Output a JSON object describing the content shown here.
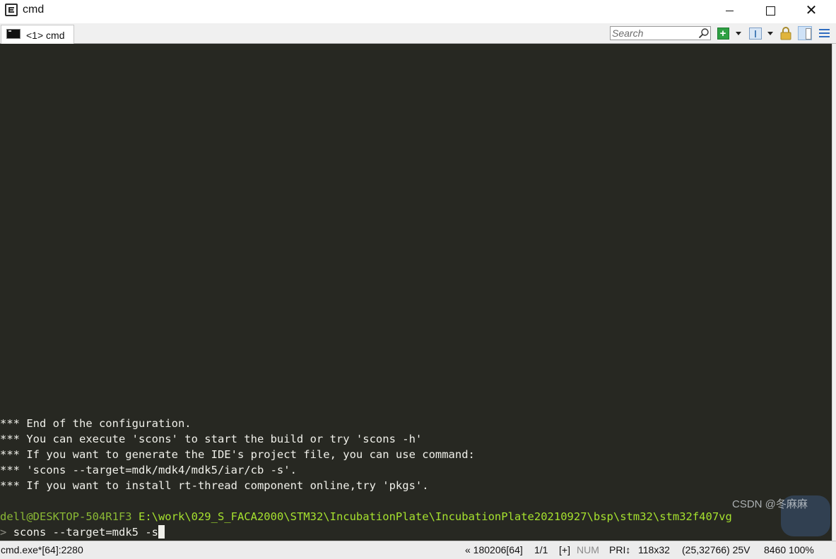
{
  "window": {
    "title": "cmd",
    "icon": "conemu-app-icon",
    "controls": [
      "minimize-icon",
      "maximize-icon",
      "close-icon"
    ]
  },
  "tabs": [
    {
      "label": "<1> cmd",
      "icon": "console-icon",
      "active": true
    }
  ],
  "toolbar": {
    "search_placeholder": "Search",
    "search_icon": "magnifier-icon",
    "buttons": [
      "new-console-plus-icon",
      "dropdown-arrow-icon",
      "split-view-icon",
      "dropdown-arrow-icon",
      "lock-icon",
      "panel-view-icon",
      "menu-icon"
    ],
    "accent_green": "#2ea043",
    "accent_blue": "#2f6cc0"
  },
  "console": {
    "background": "#272822",
    "output_lines": [
      "*** End of the configuration.",
      "*** You can execute 'scons' to start the build or try 'scons -h'",
      "*** If you want to generate the IDE's project file, you can use command:",
      "*** 'scons --target=mdk/mdk4/mdk5/iar/cb -s'.",
      "*** If you want to install rt-thread component online,try 'pkgs'."
    ],
    "prompt": {
      "user_host": "dell@DESKTOP-504R1F3",
      "path": "E:\\work\\029_S_FACA2000\\STM32\\IncubationPlate\\IncubationPlate20210927\\bsp\\stm32\\stm32f407vg",
      "arrow": ">",
      "command": "scons --target=mdk5 -s"
    }
  },
  "watermark": {
    "text": "CSDN @冬麻麻"
  },
  "statusbar": {
    "process": "cmd.exe*[64]:2280",
    "buffer": "« 180206[64]",
    "console_index": "1/1",
    "plus": "[+]",
    "num": "NUM",
    "priority": "PRI↕",
    "size": "118x32",
    "cursor": "(25,32766) 25V",
    "zoom": "8460 100%"
  }
}
